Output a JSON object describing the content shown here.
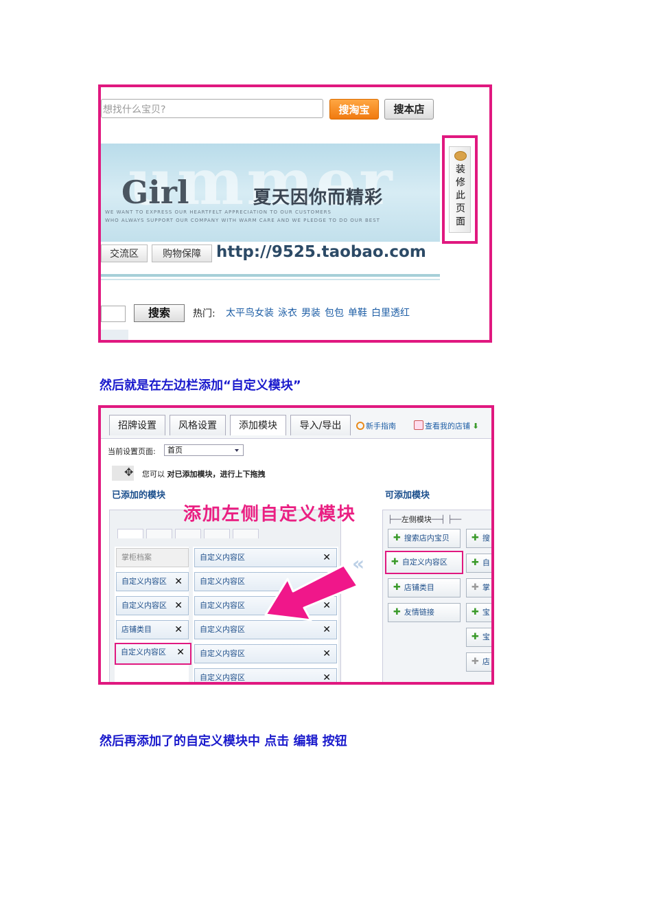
{
  "shot1": {
    "search_placeholder": "想找什么宝贝?",
    "btn_taobao": "搜淘宝",
    "btn_store": "搜本店",
    "banner_bg_word": "ummer",
    "banner_girl": "Girl",
    "banner_slogan": "夏天因你而精彩",
    "banner_line1": "WE WANT TO EXPRESS OUR HEARTFELT APPRECIATION TO OUR CUSTOMERS",
    "banner_line2": "WHO ALWAYS SUPPORT OUR COMPANY WITH WARM CARE AND WE PLEDGE TO DO OUR BEST",
    "nav_tabs": [
      "交流区",
      "购物保障"
    ],
    "banner_url": "http://9525.taobao.com",
    "side_button": "装修此页面",
    "search_button": "搜索",
    "hot_label": "热门:",
    "hot_links": [
      "太平鸟女装",
      "泳衣",
      "男装",
      "包包",
      "单鞋",
      "白里透红"
    ]
  },
  "caption1": "然后就是在左边栏添加“自定义模块”",
  "shot2": {
    "tabs": [
      "招牌设置",
      "风格设置",
      "添加模块",
      "导入/导出"
    ],
    "link_guide": "新手指南",
    "link_view": "查看我的店铺",
    "current_page_label": "当前设置页面:",
    "current_page_value": "首页",
    "drag_tip_pre": "您可以",
    "drag_tip_bold": "对已添加模块，进行上下拖拽",
    "added_title": "已添加的模块",
    "available_title": "可添加模块",
    "overlay_text": "添加左侧自定义模块",
    "left_modules_label": "左侧模块",
    "left_col": [
      {
        "label": "掌柜档案",
        "x": ""
      },
      {
        "label": "自定义内容区",
        "x": "✕"
      },
      {
        "label": "自定义内容区",
        "x": "✕"
      },
      {
        "label": "店铺类目",
        "x": "✕"
      },
      {
        "label": "自定义内容区",
        "x": "✕"
      }
    ],
    "right_col": [
      {
        "label": "自定义内容区",
        "x": "✕"
      },
      {
        "label": "自定义内容区",
        "x": "✕"
      },
      {
        "label": "自定义内容区",
        "x": "✕"
      },
      {
        "label": "自定义内容区",
        "x": "✕"
      },
      {
        "label": "自定义内容区",
        "x": "✕"
      },
      {
        "label": "自定义内容区",
        "x": "✕"
      }
    ],
    "available_left": [
      "搜索店内宝贝",
      "自定义内容区",
      "店铺类目",
      "友情链接"
    ],
    "available_right": [
      "搜",
      "自",
      "掌",
      "宝",
      "宝",
      "店"
    ]
  },
  "caption2": "然后再添加了的自定义模块中 点击 编辑 按钮"
}
